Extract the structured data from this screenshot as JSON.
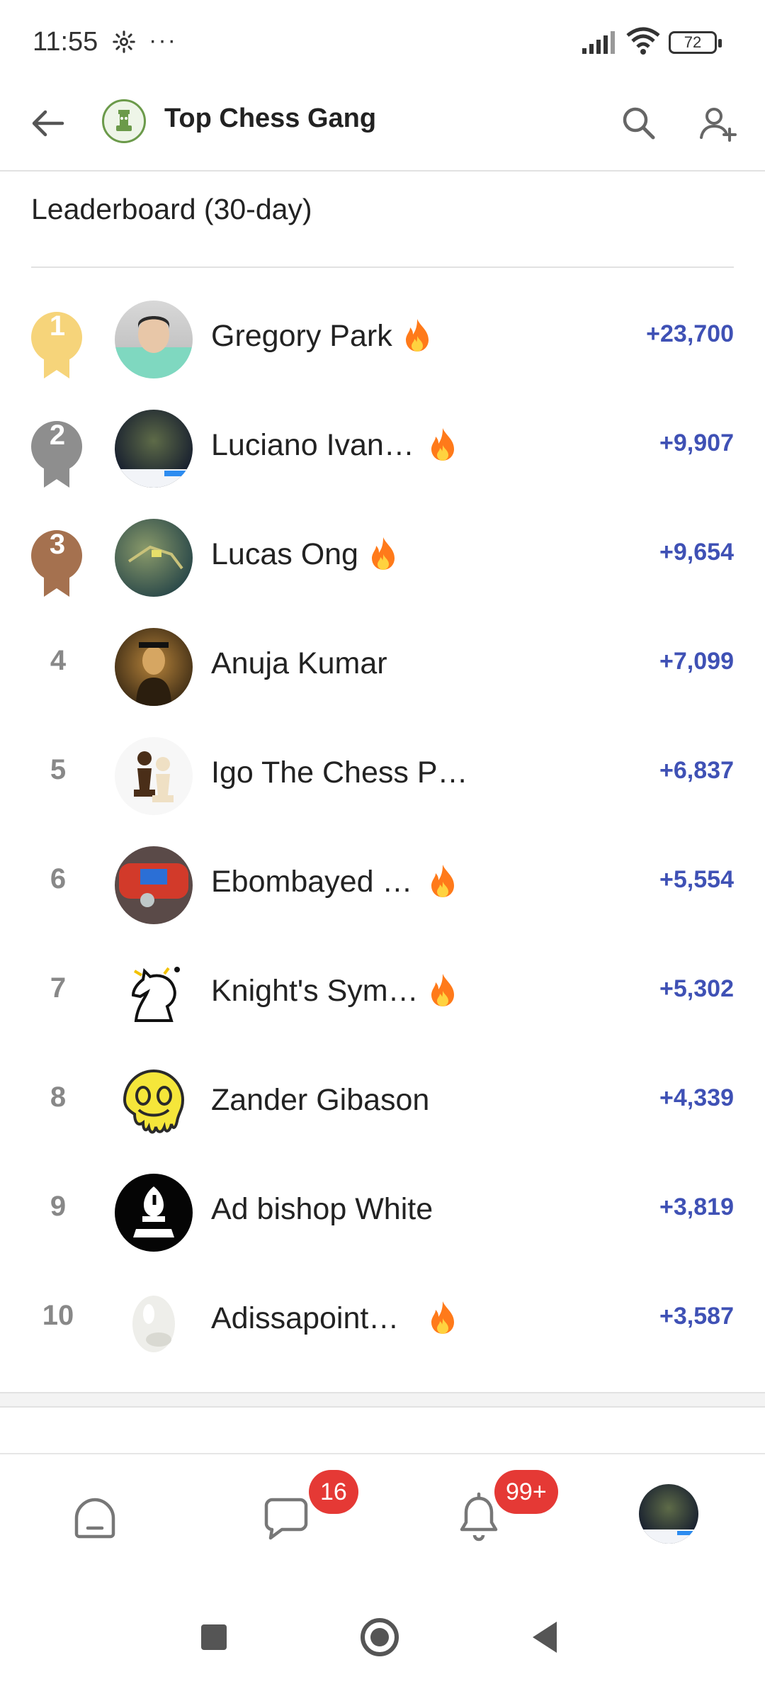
{
  "status_bar": {
    "time": "11:55",
    "more": "···",
    "battery": "72"
  },
  "header": {
    "title": "Top Chess Gang"
  },
  "leaderboard": {
    "title": "Leaderboard (30-day)",
    "rows": [
      {
        "rank": "1",
        "name": "Gregory Park",
        "score": "+23,700",
        "fire": true
      },
      {
        "rank": "2",
        "name": "Luciano Ivan…",
        "score": "+9,907",
        "fire": true
      },
      {
        "rank": "3",
        "name": "Lucas Ong",
        "score": "+9,654",
        "fire": true
      },
      {
        "rank": "4",
        "name": "Anuja Kumar",
        "score": "+7,099",
        "fire": false
      },
      {
        "rank": "5",
        "name": "Igo The Chess P…",
        "score": "+6,837",
        "fire": false
      },
      {
        "rank": "6",
        "name": "Ebombayed …",
        "score": "+5,554",
        "fire": true
      },
      {
        "rank": "7",
        "name": "Knight's Sym…",
        "score": "+5,302",
        "fire": true
      },
      {
        "rank": "8",
        "name": "Zander Gibason",
        "score": "+4,339",
        "fire": false
      },
      {
        "rank": "9",
        "name": "Ad bishop White",
        "score": "+3,819",
        "fire": false
      },
      {
        "rank": "10",
        "name": "Adissapoint…",
        "score": "+3,587",
        "fire": true
      }
    ]
  },
  "bottom_nav": {
    "messages_badge": "16",
    "notifications_badge": "99+"
  },
  "colors": {
    "score": "#3f51b5",
    "gold": "#f6d47a",
    "silver": "#8e8e8e",
    "bronze": "#a5714f",
    "badge": "#e53935"
  }
}
